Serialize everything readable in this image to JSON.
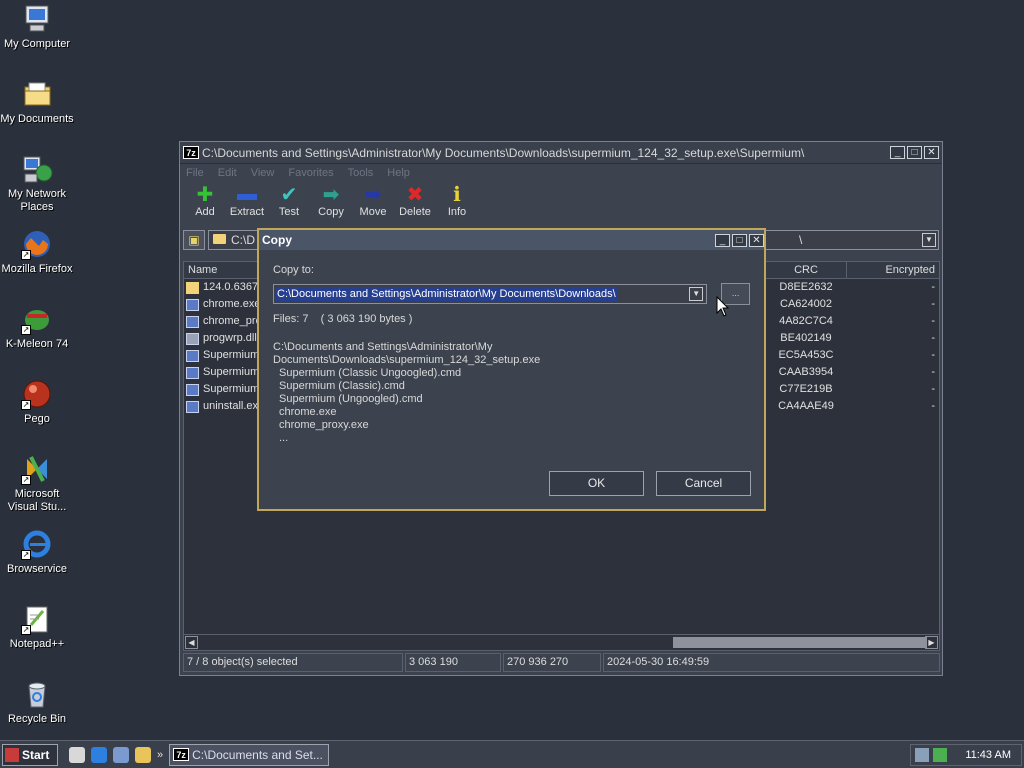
{
  "desktop": {
    "icons": [
      {
        "label": "My Computer"
      },
      {
        "label": "My Documents"
      },
      {
        "label": "My Network Places"
      },
      {
        "label": "Mozilla Firefox"
      },
      {
        "label": "K-Meleon 74"
      },
      {
        "label": "Pego"
      },
      {
        "label": "Microsoft Visual Stu..."
      },
      {
        "label": "Browservice"
      },
      {
        "label": "Notepad++"
      },
      {
        "label": "Recycle Bin"
      }
    ]
  },
  "main_window": {
    "title": "C:\\Documents and Settings\\Administrator\\My Documents\\Downloads\\supermium_124_32_setup.exe\\Supermium\\",
    "app_badge": "7z",
    "menu": [
      "File",
      "Edit",
      "View",
      "Favorites",
      "Tools",
      "Help"
    ],
    "toolbar": {
      "add": "Add",
      "extract": "Extract",
      "test": "Test",
      "copy": "Copy",
      "move": "Move",
      "delete": "Delete",
      "info": "Info"
    },
    "address": "C:\\D",
    "address_tail": "\\",
    "columns": {
      "name": "Name",
      "crc": "CRC",
      "encrypted": "Encrypted"
    },
    "rows": [
      {
        "name": "124.0.6367",
        "crc": "D8EE2632",
        "enc": "-"
      },
      {
        "name": "chrome.exe",
        "crc": "CA624002",
        "enc": "-"
      },
      {
        "name": "chrome_pro",
        "crc": "4A82C7C4",
        "enc": "-"
      },
      {
        "name": "progwrp.dll",
        "crc": "BE402149",
        "enc": "-"
      },
      {
        "name": "Supermium",
        "crc": "EC5A453C",
        "enc": "-"
      },
      {
        "name": "Supermium",
        "crc": "CAAB3954",
        "enc": "-"
      },
      {
        "name": "Supermium",
        "crc": "C77E219B",
        "enc": "-"
      },
      {
        "name": "uninstall.ex",
        "crc": "CA4AAE49",
        "enc": "-"
      }
    ],
    "status": {
      "selected": "7 / 8 object(s) selected",
      "size": "3 063 190",
      "packed": "270 936 270",
      "date": "2024-05-30 16:49:59"
    }
  },
  "copy_dialog": {
    "title": "Copy",
    "copy_to_label": "Copy to:",
    "path_value": "C:\\Documents and Settings\\Administrator\\My Documents\\Downloads\\",
    "browse_label": "...",
    "files_info": "Files: 7    ( 3 063 190 bytes )",
    "source_path": "C:\\Documents and Settings\\Administrator\\My Documents\\Downloads\\supermium_124_32_setup.exe",
    "source_items": [
      "Supermium (Classic Ungoogled).cmd",
      "Supermium (Classic).cmd",
      "Supermium (Ungoogled).cmd",
      "chrome.exe",
      "chrome_proxy.exe",
      "..."
    ],
    "ok_label": "OK",
    "cancel_label": "Cancel"
  },
  "taskbar": {
    "start_label": "Start",
    "more": "»",
    "task_label": "C:\\Documents and Set...",
    "clock": "11:43 AM"
  }
}
